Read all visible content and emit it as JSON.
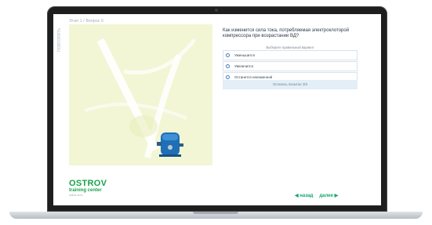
{
  "breadcrumb": "Этап 1 / Вопрос 6",
  "side_label": "ПОВТОРИТЬ",
  "question": {
    "text": "Как изменится сила тока, потребляемая электроклоторой компрессора при возрастании ВД?",
    "hint": "Выберите правильный вариант",
    "options": [
      {
        "label": "Уменьшится"
      },
      {
        "label": "Увеличится"
      },
      {
        "label": "Останется неизменной"
      }
    ],
    "attempts": "Осталось попыток: 3/3"
  },
  "logo": {
    "title": "OSTROV",
    "subtitle": "training center",
    "url": "ostrov-tc.ru"
  },
  "nav": {
    "back": "◀ назад",
    "next": "далее ▶"
  },
  "colors": {
    "accent": "#13a56b",
    "radio": "#3b7fc0",
    "illustration_bg": "#f2f6d4",
    "compressor": "#1f6fb6"
  }
}
